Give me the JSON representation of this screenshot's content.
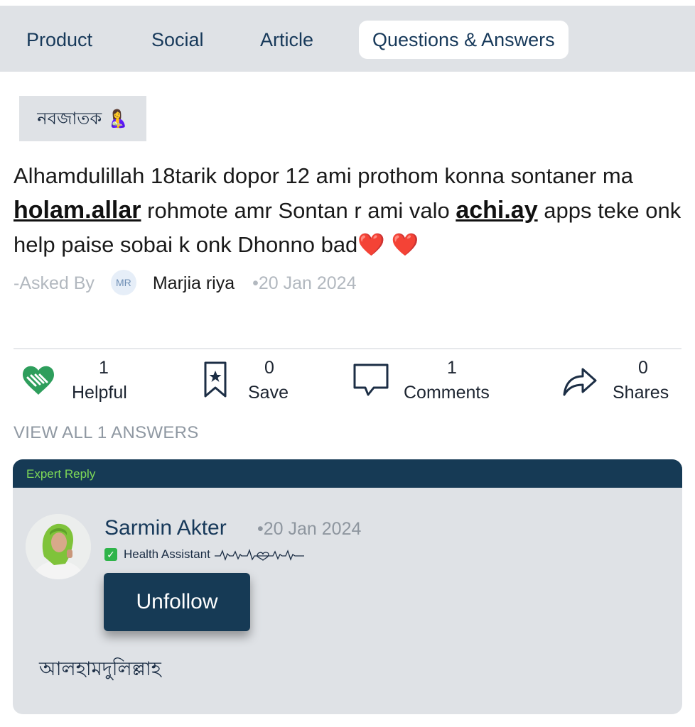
{
  "tabs": [
    {
      "label": "Product"
    },
    {
      "label": "Social"
    },
    {
      "label": "Article"
    },
    {
      "label": "Questions & Answers",
      "active": true
    }
  ],
  "category": {
    "label": "নবজাতক 🤱"
  },
  "question": {
    "part1": "Alhamdulillah 18tarik dopor 12 ami prothom konna sontaner ma ",
    "link1": "holam.allar",
    "part2": " rohmote amr Sontan r ami valo ",
    "link2": "achi.ay",
    "part3": " apps teke onk help paise sobai k onk Dhonno bad",
    "hearts": "❤️ ❤️",
    "asked_by_label": "-Asked By",
    "asker_initials": "MR",
    "asker_name": "Marjia riya",
    "date": "•20 Jan 2024"
  },
  "actions": [
    {
      "count": "1",
      "label": "Helpful",
      "icon": "helping-hands-heart-icon"
    },
    {
      "count": "0",
      "label": "Save",
      "icon": "bookmark-star-icon"
    },
    {
      "count": "1",
      "label": "Comments",
      "icon": "comment-bubble-icon"
    },
    {
      "count": "0",
      "label": "Shares",
      "icon": "share-arrow-icon"
    }
  ],
  "view_all": "VIEW ALL 1 ANSWERS",
  "answer": {
    "badge": "Expert Reply",
    "name": "Sarmin Akter",
    "date": "•20 Jan 2024",
    "role": "Health Assistant",
    "follow_label": "Unfollow",
    "text": "আলহামদুলিল্লাহ"
  },
  "colors": {
    "navy": "#163a55",
    "tab_bg": "#dfe2e6",
    "expert_green": "#7ed957",
    "helpful_green": "#2e9e5c"
  }
}
